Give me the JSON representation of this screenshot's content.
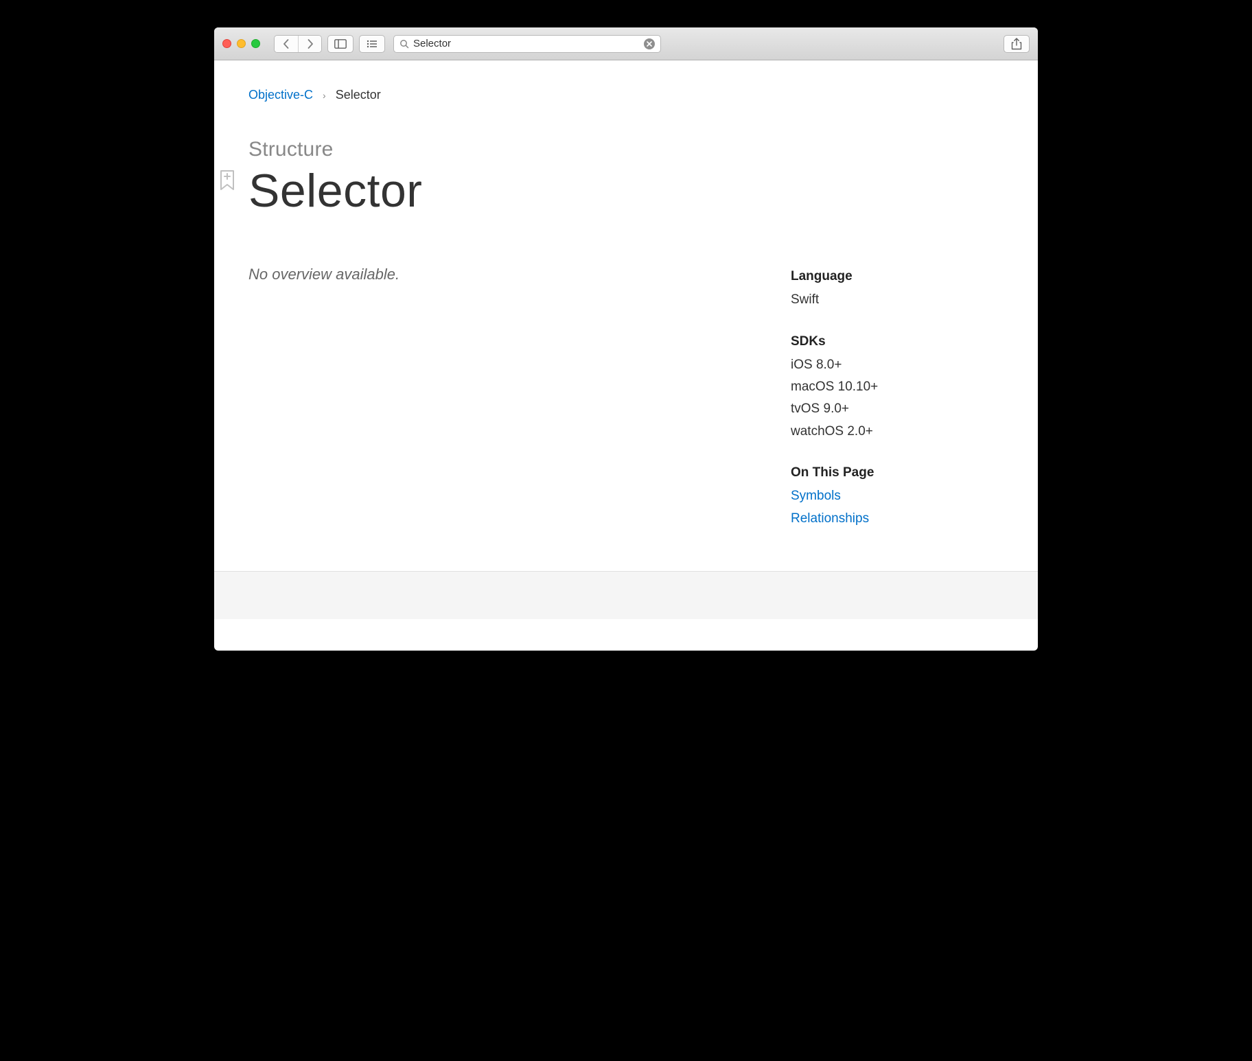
{
  "toolbar": {
    "search_value": "Selector"
  },
  "breadcrumb": {
    "parent": "Objective-C",
    "separator": "›",
    "current": "Selector"
  },
  "header": {
    "kind": "Structure",
    "title": "Selector"
  },
  "overview": {
    "text": "No overview available."
  },
  "sidebar": {
    "language_heading": "Language",
    "language_value": "Swift",
    "sdks_heading": "SDKs",
    "sdks": [
      "iOS 8.0+",
      "macOS 10.10+",
      "tvOS 9.0+",
      "watchOS 2.0+"
    ],
    "onthispage_heading": "On This Page",
    "links": [
      "Symbols",
      "Relationships"
    ]
  }
}
